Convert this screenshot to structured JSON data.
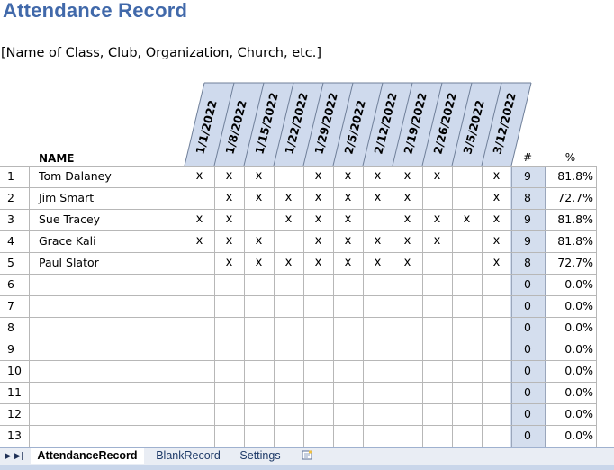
{
  "title": "Attendance Record",
  "subtitle": "[Name of Class, Club, Organization, Church, etc.]",
  "headers": {
    "name": "NAME",
    "count": "#",
    "percent": "%"
  },
  "dates": [
    "1/1/2022",
    "1/8/2022",
    "1/15/2022",
    "1/22/2022",
    "1/29/2022",
    "2/5/2022",
    "2/12/2022",
    "2/19/2022",
    "2/26/2022",
    "3/5/2022",
    "3/12/2022"
  ],
  "rows": [
    {
      "idx": "1",
      "name": "Tom Dalaney",
      "marks": [
        "x",
        "x",
        "x",
        "",
        "x",
        "x",
        "x",
        "x",
        "x",
        "",
        "x"
      ],
      "count": "9",
      "percent": "81.8%"
    },
    {
      "idx": "2",
      "name": "Jim Smart",
      "marks": [
        "",
        "x",
        "x",
        "x",
        "x",
        "x",
        "x",
        "x",
        "",
        "",
        "x"
      ],
      "count": "8",
      "percent": "72.7%"
    },
    {
      "idx": "3",
      "name": "Sue Tracey",
      "marks": [
        "x",
        "x",
        "",
        "x",
        "x",
        "x",
        "",
        "x",
        "x",
        "x",
        "x"
      ],
      "count": "9",
      "percent": "81.8%"
    },
    {
      "idx": "4",
      "name": "Grace Kali",
      "marks": [
        "x",
        "x",
        "x",
        "",
        "x",
        "x",
        "x",
        "x",
        "x",
        "",
        "x"
      ],
      "count": "9",
      "percent": "81.8%"
    },
    {
      "idx": "5",
      "name": "Paul Slator",
      "marks": [
        "",
        "x",
        "x",
        "x",
        "x",
        "x",
        "x",
        "x",
        "",
        "",
        "x"
      ],
      "count": "8",
      "percent": "72.7%"
    },
    {
      "idx": "6",
      "name": "",
      "marks": [
        "",
        "",
        "",
        "",
        "",
        "",
        "",
        "",
        "",
        "",
        ""
      ],
      "count": "0",
      "percent": "0.0%"
    },
    {
      "idx": "7",
      "name": "",
      "marks": [
        "",
        "",
        "",
        "",
        "",
        "",
        "",
        "",
        "",
        "",
        ""
      ],
      "count": "0",
      "percent": "0.0%"
    },
    {
      "idx": "8",
      "name": "",
      "marks": [
        "",
        "",
        "",
        "",
        "",
        "",
        "",
        "",
        "",
        "",
        ""
      ],
      "count": "0",
      "percent": "0.0%"
    },
    {
      "idx": "9",
      "name": "",
      "marks": [
        "",
        "",
        "",
        "",
        "",
        "",
        "",
        "",
        "",
        "",
        ""
      ],
      "count": "0",
      "percent": "0.0%"
    },
    {
      "idx": "10",
      "name": "",
      "marks": [
        "",
        "",
        "",
        "",
        "",
        "",
        "",
        "",
        "",
        "",
        ""
      ],
      "count": "0",
      "percent": "0.0%"
    },
    {
      "idx": "11",
      "name": "",
      "marks": [
        "",
        "",
        "",
        "",
        "",
        "",
        "",
        "",
        "",
        "",
        ""
      ],
      "count": "0",
      "percent": "0.0%"
    },
    {
      "idx": "12",
      "name": "",
      "marks": [
        "",
        "",
        "",
        "",
        "",
        "",
        "",
        "",
        "",
        "",
        ""
      ],
      "count": "0",
      "percent": "0.0%"
    },
    {
      "idx": "13",
      "name": "",
      "marks": [
        "",
        "",
        "",
        "",
        "",
        "",
        "",
        "",
        "",
        "",
        ""
      ],
      "count": "0",
      "percent": "0.0%"
    }
  ],
  "sheet_tabs": [
    {
      "label": "AttendanceRecord",
      "active": true
    },
    {
      "label": "BlankRecord",
      "active": false
    },
    {
      "label": "Settings",
      "active": false
    }
  ],
  "colors": {
    "title": "#4169aa",
    "header_band": "#cfdaed",
    "count_column": "#d4deee",
    "grid_line": "#b7b7b7"
  }
}
